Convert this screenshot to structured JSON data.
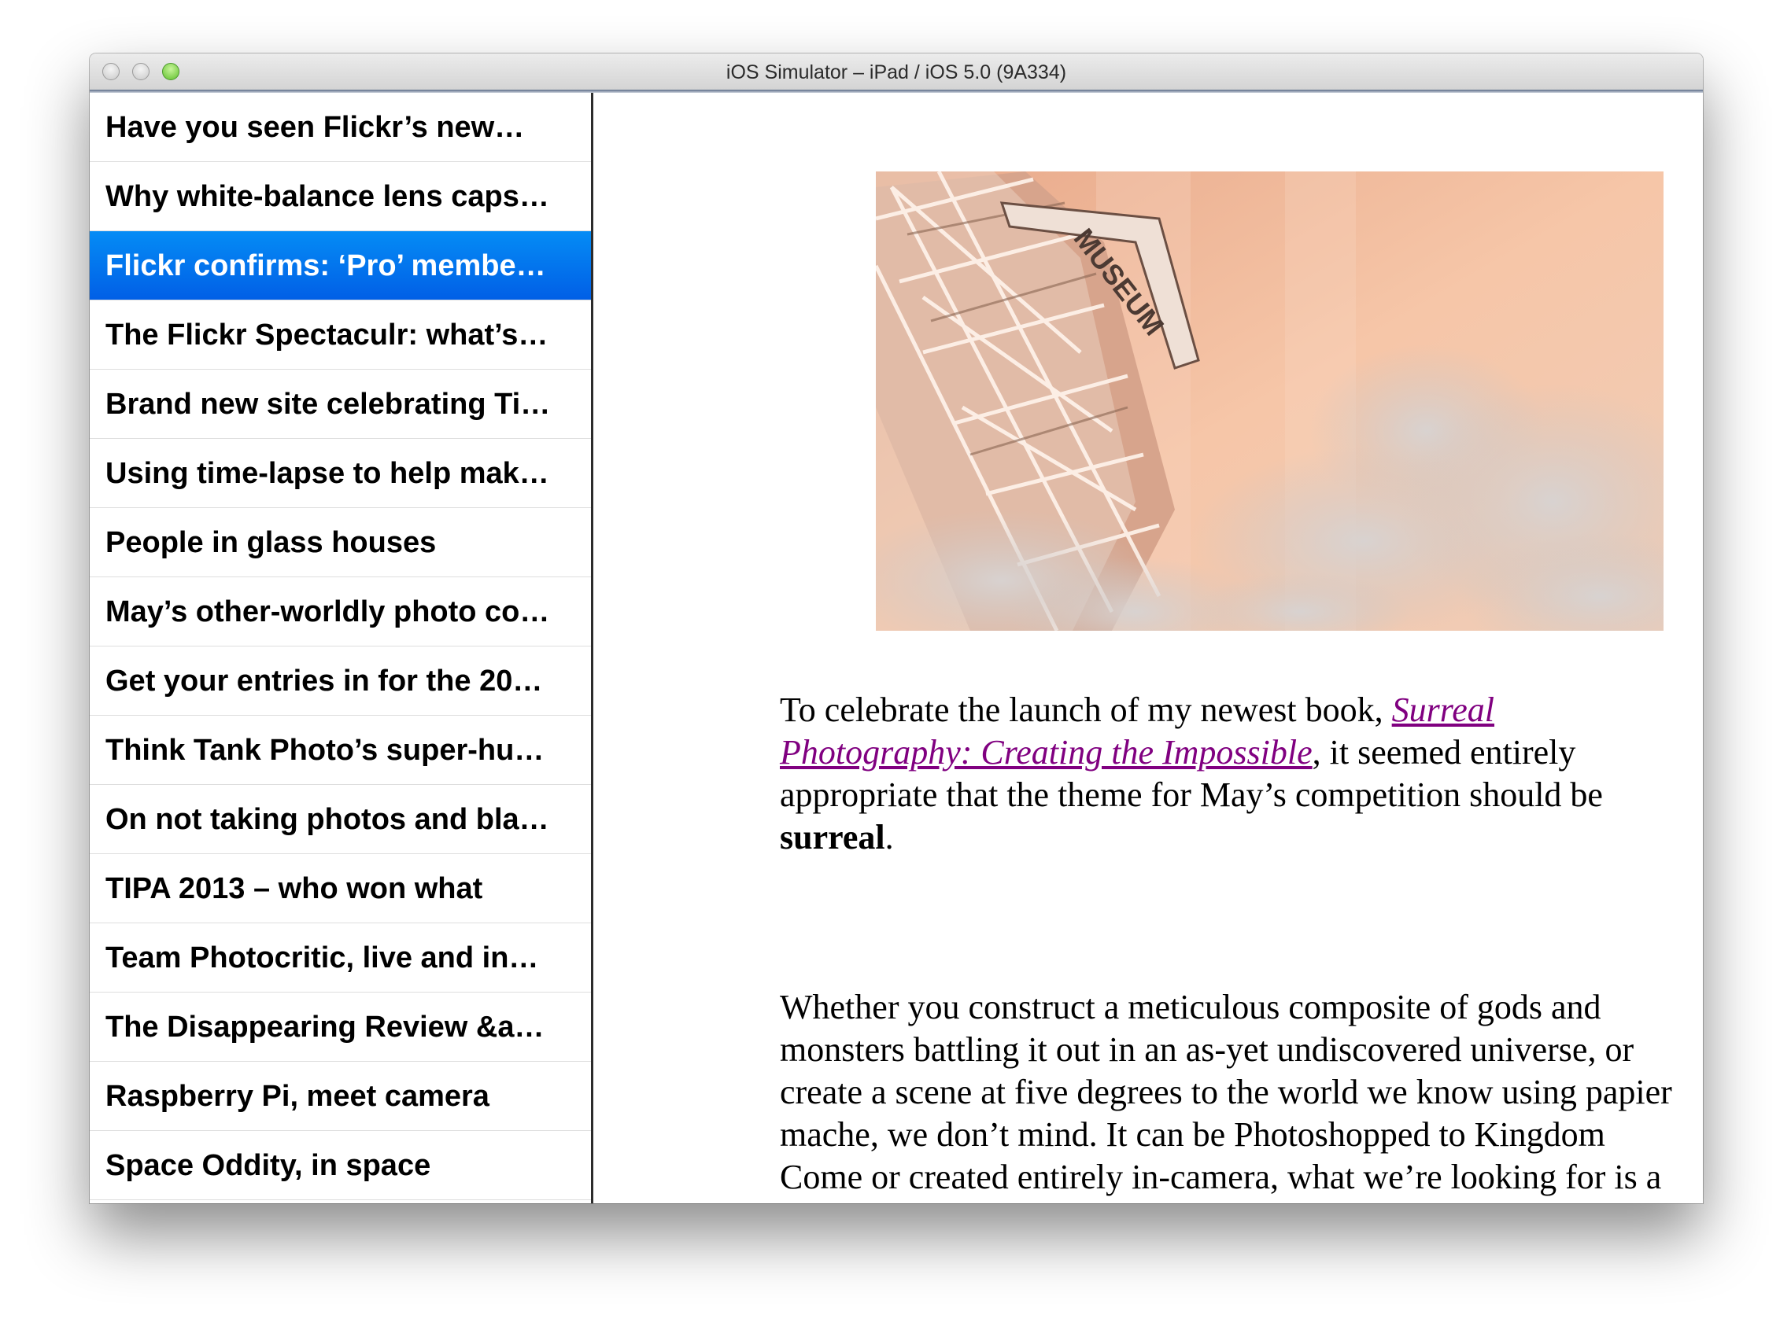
{
  "window": {
    "title": "iOS Simulator – iPad / iOS 5.0 (9A334)"
  },
  "master": {
    "items": [
      {
        "label": "Have you seen Flickr’s new…",
        "selected": false
      },
      {
        "label": "Why white-balance lens caps…",
        "selected": false
      },
      {
        "label": "Flickr confirms: ‘Pro’ membe…",
        "selected": true
      },
      {
        "label": "The Flickr Spectaculr: what’s…",
        "selected": false
      },
      {
        "label": "Brand new site celebrating Ti…",
        "selected": false
      },
      {
        "label": "Using time-lapse to help mak…",
        "selected": false
      },
      {
        "label": "People in glass houses",
        "selected": false
      },
      {
        "label": "May’s other-worldly photo co…",
        "selected": false
      },
      {
        "label": "Get your entries in for the 20…",
        "selected": false
      },
      {
        "label": "Think Tank Photo’s super-hu…",
        "selected": false
      },
      {
        "label": "On not taking photos and bla…",
        "selected": false
      },
      {
        "label": "TIPA 2013 – who won what",
        "selected": false
      },
      {
        "label": "Team Photocritic, live and in…",
        "selected": false
      },
      {
        "label": "The Disappearing Review &a…",
        "selected": false
      },
      {
        "label": "Raspberry Pi, meet camera",
        "selected": false
      },
      {
        "label": "Space Oddity, in space",
        "selected": false
      }
    ]
  },
  "detail": {
    "image_label": "MUSEUM",
    "paragraph1": {
      "before": "To celebrate the launch of my newest book, ",
      "link": "Surreal Photography: Creating the Impossible",
      "middle": ", it seemed entirely appropriate that the theme for May’s competition should be ",
      "bold": "surreal",
      "after": "."
    },
    "paragraph2": "Whether you construct a meticulous composite of gods and monsters battling it out in an as-yet undiscovered universe, or create a scene at five degrees to the world we know using papier mache, we don’t mind. It can be Photoshopped to Kingdom Come or created entirely in-camera, what we’re looking for is a"
  },
  "colors": {
    "selection": "#0170ee",
    "link": "#800080",
    "photo_tone": "#f4c0a3"
  }
}
